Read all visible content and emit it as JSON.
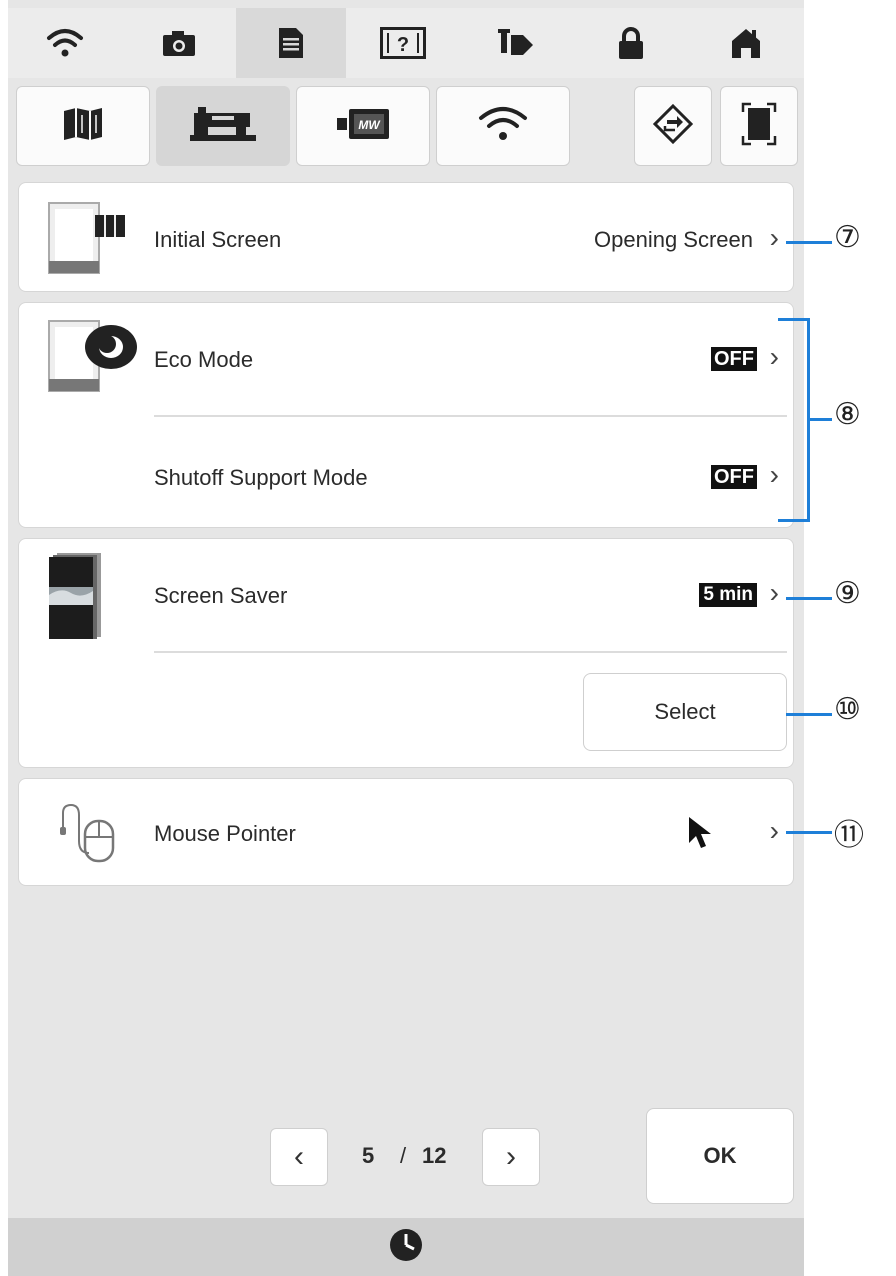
{
  "toolbar": {
    "icons": [
      "wifi-icon",
      "camera-icon",
      "document-icon",
      "help-icon",
      "thread-icon",
      "lock-icon",
      "home-icon"
    ],
    "active_index": 2
  },
  "tabs": {
    "icons": [
      "map-icon",
      "sewing-machine-icon",
      "embroidery-icon",
      "wifi-icon",
      "update-icon",
      "frame-icon"
    ],
    "selected_index": 1
  },
  "settings": {
    "initial_screen": {
      "label": "Initial Screen",
      "value": "Opening Screen"
    },
    "eco_mode": {
      "label": "Eco Mode",
      "value": "OFF"
    },
    "shutoff_support": {
      "label": "Shutoff Support Mode",
      "value": "OFF"
    },
    "screen_saver": {
      "label": "Screen Saver",
      "value": "5 min",
      "select_label": "Select"
    },
    "mouse_pointer": {
      "label": "Mouse Pointer"
    }
  },
  "pager": {
    "current": "5",
    "separator": "/",
    "total": "12"
  },
  "ok_label": "OK",
  "callouts": {
    "c7": "⑦",
    "c8": "⑧",
    "c9": "⑨",
    "c10": "⑩",
    "c11": "⑪"
  },
  "colors": {
    "callout": "#1e7fd8",
    "selected_tab": "#d6d6d6",
    "badge": "#111111"
  }
}
